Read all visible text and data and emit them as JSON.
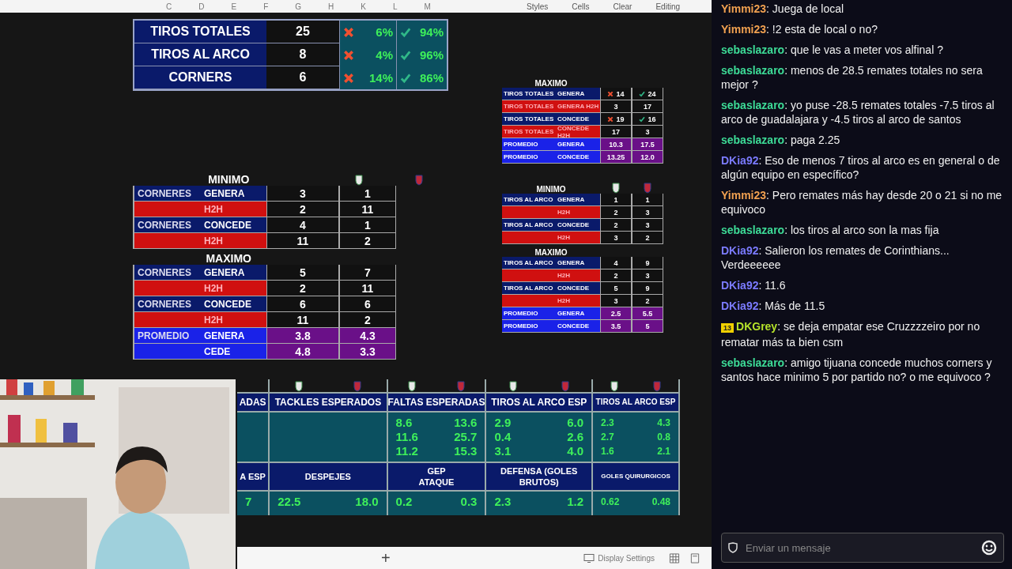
{
  "sheet": {
    "columns": [
      "C",
      "D",
      "E",
      "F",
      "G",
      "H",
      "K",
      "L",
      "M"
    ],
    "ribbon": [
      "Styles",
      "Cells",
      "Clear",
      "Editing"
    ],
    "summary": [
      {
        "label": "TIROS TOTALES",
        "value": "25",
        "under": "6%",
        "over": "94%"
      },
      {
        "label": "TIROS AL ARCO",
        "value": "8",
        "under": "4%",
        "over": "96%"
      },
      {
        "label": "CORNERS",
        "value": "6",
        "under": "14%",
        "over": "86%"
      }
    ],
    "totals_max": {
      "title": "MAXIMO",
      "rows": [
        {
          "kind": "team",
          "label": "TIROS TOTALES",
          "sub": "GENERA",
          "a": "14",
          "b": "24",
          "a_cross": true,
          "b_check": true
        },
        {
          "kind": "h2h",
          "label": "TIROS TOTALES",
          "sub": "GENERA H2H",
          "a": "3",
          "b": "17"
        },
        {
          "kind": "team",
          "label": "TIROS TOTALES",
          "sub": "CONCEDE",
          "a": "19",
          "b": "16",
          "a_cross": true,
          "b_check": true
        },
        {
          "kind": "h2h",
          "label": "TIROS TOTALES",
          "sub": "CONCEDE H2H",
          "a": "17",
          "b": "3"
        },
        {
          "kind": "avg",
          "label": "PROMEDIO",
          "sub": "GENERA",
          "a": "10.3",
          "b": "17.5"
        },
        {
          "kind": "avg",
          "label": "PROMEDIO",
          "sub": "CONCEDE",
          "a": "13.25",
          "b": "12.0"
        }
      ]
    },
    "corners": [
      {
        "title": "MINIMO",
        "crests": true,
        "rows": [
          {
            "kind": "team",
            "label": "CORNERES",
            "sub": "GENERA",
            "a": "3",
            "b": "1"
          },
          {
            "kind": "h2h",
            "sub": "H2H",
            "a": "2",
            "b": "11"
          },
          {
            "kind": "team",
            "label": "CORNERES",
            "sub": "CONCEDE",
            "a": "4",
            "b": "1"
          },
          {
            "kind": "h2h",
            "sub": "H2H",
            "a": "11",
            "b": "2"
          }
        ]
      },
      {
        "title": "MAXIMO",
        "crests": false,
        "rows": [
          {
            "kind": "team",
            "label": "CORNERES",
            "sub": "GENERA",
            "a": "5",
            "b": "7"
          },
          {
            "kind": "h2h",
            "sub": "H2H",
            "a": "2",
            "b": "11"
          },
          {
            "kind": "team",
            "label": "CORNERES",
            "sub": "CONCEDE",
            "a": "6",
            "b": "6"
          },
          {
            "kind": "h2h",
            "sub": "H2H",
            "a": "11",
            "b": "2"
          },
          {
            "kind": "avg",
            "label": "PROMEDIO",
            "sub": "GENERA",
            "a": "3.8",
            "b": "4.3"
          },
          {
            "kind": "avg",
            "sub": "CEDE",
            "a": "4.8",
            "b": "3.3"
          }
        ]
      }
    ],
    "shots": [
      {
        "title": "MINIMO",
        "crests": true,
        "rows": [
          {
            "kind": "team",
            "label": "TIROS AL ARCO",
            "sub": "GENERA",
            "a": "1",
            "b": "1"
          },
          {
            "kind": "h2h",
            "sub": "H2H",
            "a": "2",
            "b": "3"
          },
          {
            "kind": "team",
            "label": "TIROS AL ARCO",
            "sub": "CONCEDE",
            "a": "2",
            "b": "3"
          },
          {
            "kind": "h2h",
            "sub": "H2H",
            "a": "3",
            "b": "2"
          }
        ]
      },
      {
        "title": "MAXIMO",
        "crests": false,
        "rows": [
          {
            "kind": "team",
            "label": "TIROS AL ARCO",
            "sub": "GENERA",
            "a": "4",
            "b": "9"
          },
          {
            "kind": "h2h",
            "sub": "H2H",
            "a": "2",
            "b": "3"
          },
          {
            "kind": "team",
            "label": "TIROS AL ARCO",
            "sub": "CONCEDE",
            "a": "5",
            "b": "9"
          },
          {
            "kind": "h2h",
            "sub": "H2H",
            "a": "3",
            "b": "2"
          },
          {
            "kind": "avg",
            "label": "PROMEDIO",
            "sub": "GENERA",
            "a": "2.5",
            "b": "5.5"
          },
          {
            "kind": "avg",
            "label": "PROMEDIO",
            "sub": "CONCEDE",
            "a": "3.5",
            "b": "5"
          }
        ]
      }
    ],
    "expected": [
      {
        "crests": false,
        "top": {
          "title": "ADAS"
        },
        "bottom": {
          "title": "A ESP",
          "pairs": [
            [
              "7"
            ]
          ]
        }
      },
      {
        "crests": true,
        "top": {
          "title": "TACKLES ESPERADOS"
        },
        "bottom": {
          "title": "DESPEJES",
          "pairs": [
            [
              "22.5",
              "18.0"
            ]
          ]
        }
      },
      {
        "crests": true,
        "top": {
          "title": "FALTAS ESPERADAS",
          "pairs": [
            [
              "8.6",
              "13.6"
            ],
            [
              "11.6",
              "25.7"
            ],
            [
              "11.2",
              "15.3"
            ]
          ]
        },
        "bottom": {
          "title": "GEP",
          "subtitle": "ATAQUE",
          "pairs": [
            [
              "0.2",
              "0.3"
            ]
          ]
        }
      },
      {
        "crests": true,
        "top": {
          "title": "TIROS AL ARCO ESP",
          "pairs": [
            [
              "2.9",
              "6.0"
            ],
            [
              "0.4",
              "2.6"
            ],
            [
              "3.1",
              "4.0"
            ]
          ]
        },
        "bottom": {
          "title": "DEFENSA (GOLES BRUTOS)",
          "pairs": [
            [
              "2.3",
              "1.2"
            ]
          ]
        }
      },
      {
        "crests": true,
        "top": {
          "title": "TIROS AL ARCO ESP",
          "pairs": [
            [
              "2.3",
              "4.3"
            ],
            [
              "2.7",
              "0.8"
            ],
            [
              "1.6",
              "2.1"
            ]
          ]
        },
        "bottom": {
          "title": "GOLES QUIRURGICOS",
          "pairs": [
            [
              "0.62",
              "0.48"
            ]
          ]
        }
      }
    ],
    "status": {
      "add": "+",
      "display": "Display Settings"
    }
  },
  "chat": {
    "messages": [
      {
        "user": "Yimmi23",
        "color": "#f0a050",
        "text": ": Juega de local"
      },
      {
        "user": "Yimmi23",
        "color": "#f0a050",
        "text": ": !2 esta de local o no?"
      },
      {
        "user": "sebaslazaro",
        "color": "#3ddc97",
        "text": ": que le vas a meter vos alfinal ?"
      },
      {
        "user": "sebaslazaro",
        "color": "#3ddc97",
        "text": ": menos de 28.5 remates totales no sera mejor ?"
      },
      {
        "user": "sebaslazaro",
        "color": "#3ddc97",
        "text": ": yo puse -28.5 remates totales -7.5 tiros al arco de guadalajara y -4.5 tiros al arco de santos"
      },
      {
        "user": "sebaslazaro",
        "color": "#3ddc97",
        "text": ": paga 2.25"
      },
      {
        "user": "DKia92",
        "color": "#7b7bff",
        "text": ": Eso de menos 7 tiros al arco es en general o de algún equipo en específico?"
      },
      {
        "user": "Yimmi23",
        "color": "#f0a050",
        "text": ": Pero remates más hay desde 20 o 21 si no me equivoco"
      },
      {
        "user": "sebaslazaro",
        "color": "#3ddc97",
        "text": ": los tiros al arco son la mas fija"
      },
      {
        "user": "DKia92",
        "color": "#7b7bff",
        "text": ": Salieron los remates de Corinthians... Verdeeeeee"
      },
      {
        "user": "DKia92",
        "color": "#7b7bff",
        "text": ": 11.6"
      },
      {
        "user": "DKia92",
        "color": "#7b7bff",
        "text": ": Más de 11.5"
      },
      {
        "user": "DKGrey",
        "color": "#b6e32a",
        "badge": "13",
        "text": ": se deja empatar ese Cruzzzzeiro por no rematar más ta bien csm"
      },
      {
        "user": "sebaslazaro",
        "color": "#3ddc97",
        "text": ": amigo tijuana concede muchos corners y santos hace minimo 5 por partido no? o me equivoco ?"
      }
    ],
    "input": {
      "placeholder": "Enviar un mensaje"
    }
  }
}
